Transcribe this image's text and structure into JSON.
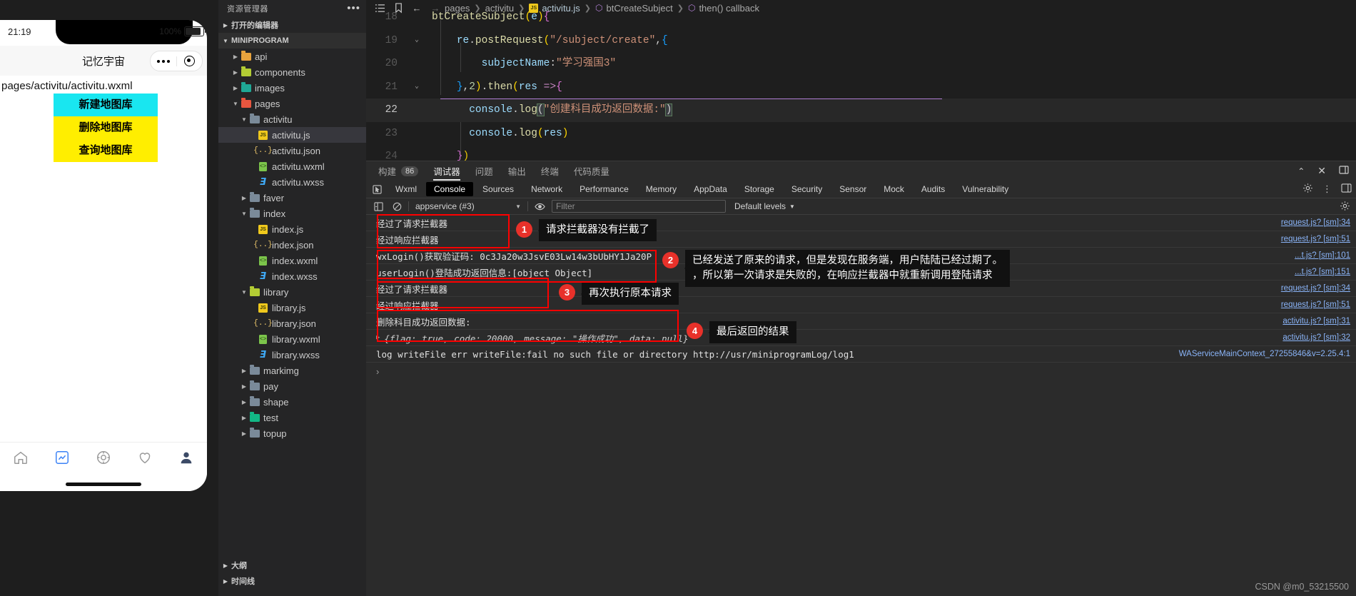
{
  "simulator": {
    "status_bar": {
      "time": "21:19",
      "battery_percent": "100%"
    },
    "nav_title": "记忆宇宙",
    "page_path": "pages/activitu/activitu.wxml",
    "buttons": [
      {
        "label": "新建地图库",
        "color": "#19e6f0"
      },
      {
        "label": "删除地图库",
        "color": "#ffee00"
      },
      {
        "label": "查询地图库",
        "color": "#ffee00"
      }
    ],
    "tabbar_icons": [
      "home-icon",
      "chart-icon",
      "compass-icon",
      "heart-icon",
      "person-icon"
    ]
  },
  "explorer": {
    "title": "资源管理器",
    "more_icon": "ellipsis-icon",
    "open_editors_label": "打开的编辑器",
    "project_label": "MINIPROGRAM",
    "tree": [
      {
        "label": "api",
        "type": "folder",
        "icon": "folder-api",
        "depth": 1,
        "expanded": false
      },
      {
        "label": "components",
        "type": "folder",
        "icon": "folder-comp",
        "depth": 1,
        "expanded": false
      },
      {
        "label": "images",
        "type": "folder",
        "icon": "folder-img",
        "depth": 1,
        "expanded": false
      },
      {
        "label": "pages",
        "type": "folder",
        "icon": "folder-pages",
        "depth": 1,
        "expanded": true
      },
      {
        "label": "activitu",
        "type": "folder",
        "icon": "folder-plain",
        "depth": 2,
        "expanded": true
      },
      {
        "label": "activitu.js",
        "type": "js",
        "depth": 3,
        "selected": true
      },
      {
        "label": "activitu.json",
        "type": "json",
        "depth": 3
      },
      {
        "label": "activitu.wxml",
        "type": "wxml",
        "depth": 3
      },
      {
        "label": "activitu.wxss",
        "type": "wxss",
        "depth": 3
      },
      {
        "label": "faver",
        "type": "folder",
        "icon": "folder-plain",
        "depth": 2,
        "expanded": false
      },
      {
        "label": "index",
        "type": "folder",
        "icon": "folder-plain",
        "depth": 2,
        "expanded": true
      },
      {
        "label": "index.js",
        "type": "js",
        "depth": 3
      },
      {
        "label": "index.json",
        "type": "json",
        "depth": 3
      },
      {
        "label": "index.wxml",
        "type": "wxml",
        "depth": 3
      },
      {
        "label": "index.wxss",
        "type": "wxss",
        "depth": 3
      },
      {
        "label": "library",
        "type": "folder",
        "icon": "folder-lib",
        "depth": 2,
        "expanded": true
      },
      {
        "label": "library.js",
        "type": "js",
        "depth": 3
      },
      {
        "label": "library.json",
        "type": "json",
        "depth": 3
      },
      {
        "label": "library.wxml",
        "type": "wxml",
        "depth": 3
      },
      {
        "label": "library.wxss",
        "type": "wxss",
        "depth": 3
      },
      {
        "label": "markimg",
        "type": "folder",
        "icon": "folder-plain",
        "depth": 2,
        "expanded": false
      },
      {
        "label": "pay",
        "type": "folder",
        "icon": "folder-plain",
        "depth": 2,
        "expanded": false
      },
      {
        "label": "shape",
        "type": "folder",
        "icon": "folder-plain",
        "depth": 2,
        "expanded": false
      },
      {
        "label": "test",
        "type": "folder",
        "icon": "folder-test",
        "depth": 2,
        "expanded": false
      },
      {
        "label": "topup",
        "type": "folder",
        "icon": "folder-plain",
        "depth": 2,
        "expanded": false
      }
    ],
    "outline_label": "大纲",
    "timeline_label": "时间线"
  },
  "editor": {
    "breadcrumb": [
      "pages",
      "activitu",
      "activitu.js",
      "btCreateSubject",
      "then() callback"
    ],
    "breadcrumb_file": "activitu.js",
    "lines": [
      {
        "n": "18",
        "text": "btCreateSubject(e){"
      },
      {
        "n": "19",
        "text": "re.postRequest(\"/subject/create\",{"
      },
      {
        "n": "20",
        "text": "subjectName:\"学习强国3\""
      },
      {
        "n": "21",
        "text": "},2).then(res =>{"
      },
      {
        "n": "22",
        "text": "console.log(\"创建科目成功返回数据:\")"
      },
      {
        "n": "23",
        "text": "console.log(res)"
      },
      {
        "n": "24",
        "text": "})"
      }
    ],
    "current_line": "22"
  },
  "ide_panel": {
    "tabs": [
      {
        "label": "构建",
        "badge": "86",
        "active": false
      },
      {
        "label": "调试器",
        "badge": "",
        "active": true
      },
      {
        "label": "问题",
        "badge": "",
        "active": false
      },
      {
        "label": "输出",
        "badge": "",
        "active": false
      },
      {
        "label": "终端",
        "badge": "",
        "active": false
      },
      {
        "label": "代码质量",
        "badge": "",
        "active": false
      }
    ],
    "tools": [
      "chevron-up-icon",
      "close-icon",
      "layout-icon"
    ]
  },
  "devtools": {
    "inspect_icon": "inspect-element-icon",
    "tabs": [
      "Wxml",
      "Console",
      "Sources",
      "Network",
      "Performance",
      "Memory",
      "AppData",
      "Storage",
      "Security",
      "Sensor",
      "Mock",
      "Audits",
      "Vulnerability"
    ],
    "active_tab": "Console",
    "right_icons": [
      "settings-gear-icon",
      "more-vertical-icon",
      "dock-icon"
    ],
    "toolbar": {
      "clear_icon": "clear-console-icon",
      "context": "appservice (#3)",
      "eye_icon": "eye-icon",
      "filter_placeholder": "Filter",
      "levels": "Default levels",
      "gear_icon": "console-settings-icon"
    },
    "messages": [
      {
        "text": "经过了请求拦截器",
        "source": "request.js? [sm]:34"
      },
      {
        "text": "经过响应拦截器",
        "source": "request.js? [sm]:51"
      },
      {
        "text": "wxLogin()获取验证码: 0c3Ja20w3JsvE03Lw14w3bUbHY1Ja20P",
        "source": "...t.js? [sm]:101"
      },
      {
        "text": "userLogin()登陆成功返回信息:[object Object]",
        "source": "...t.js? [sm]:151"
      },
      {
        "text": "经过了请求拦截器",
        "source": "request.js? [sm]:34"
      },
      {
        "text": "经过响应拦截器",
        "source": "request.js? [sm]:51"
      },
      {
        "text": "删除科目成功返回数据:",
        "source": "activitu.js? [sm]:31"
      },
      {
        "text": "{flag: true, code: 20000, message: \"操作成功\", data: null}",
        "source": "activitu.js? [sm]:32",
        "expandable": true
      },
      {
        "text": "log writeFile err writeFile:fail no such file or directory http://usr/miniprogramLog/log1",
        "source": "WAServiceMainContext_27255846&v=2.25.4:1"
      }
    ],
    "prompt_symbol": "›"
  },
  "annotations": [
    {
      "num": "1",
      "text": "请求拦截器没有拦截了"
    },
    {
      "num": "2",
      "text": "已经发送了原来的请求，但是发现在服务端，用户陆陆已经过期了。\n，所以第一次请求是失败的，在响应拦截器中就重新调用登陆请求"
    },
    {
      "num": "3",
      "text": "再次执行原本请求"
    },
    {
      "num": "4",
      "text": "最后返回的结果"
    }
  ],
  "watermark": "CSDN @m0_53215500"
}
